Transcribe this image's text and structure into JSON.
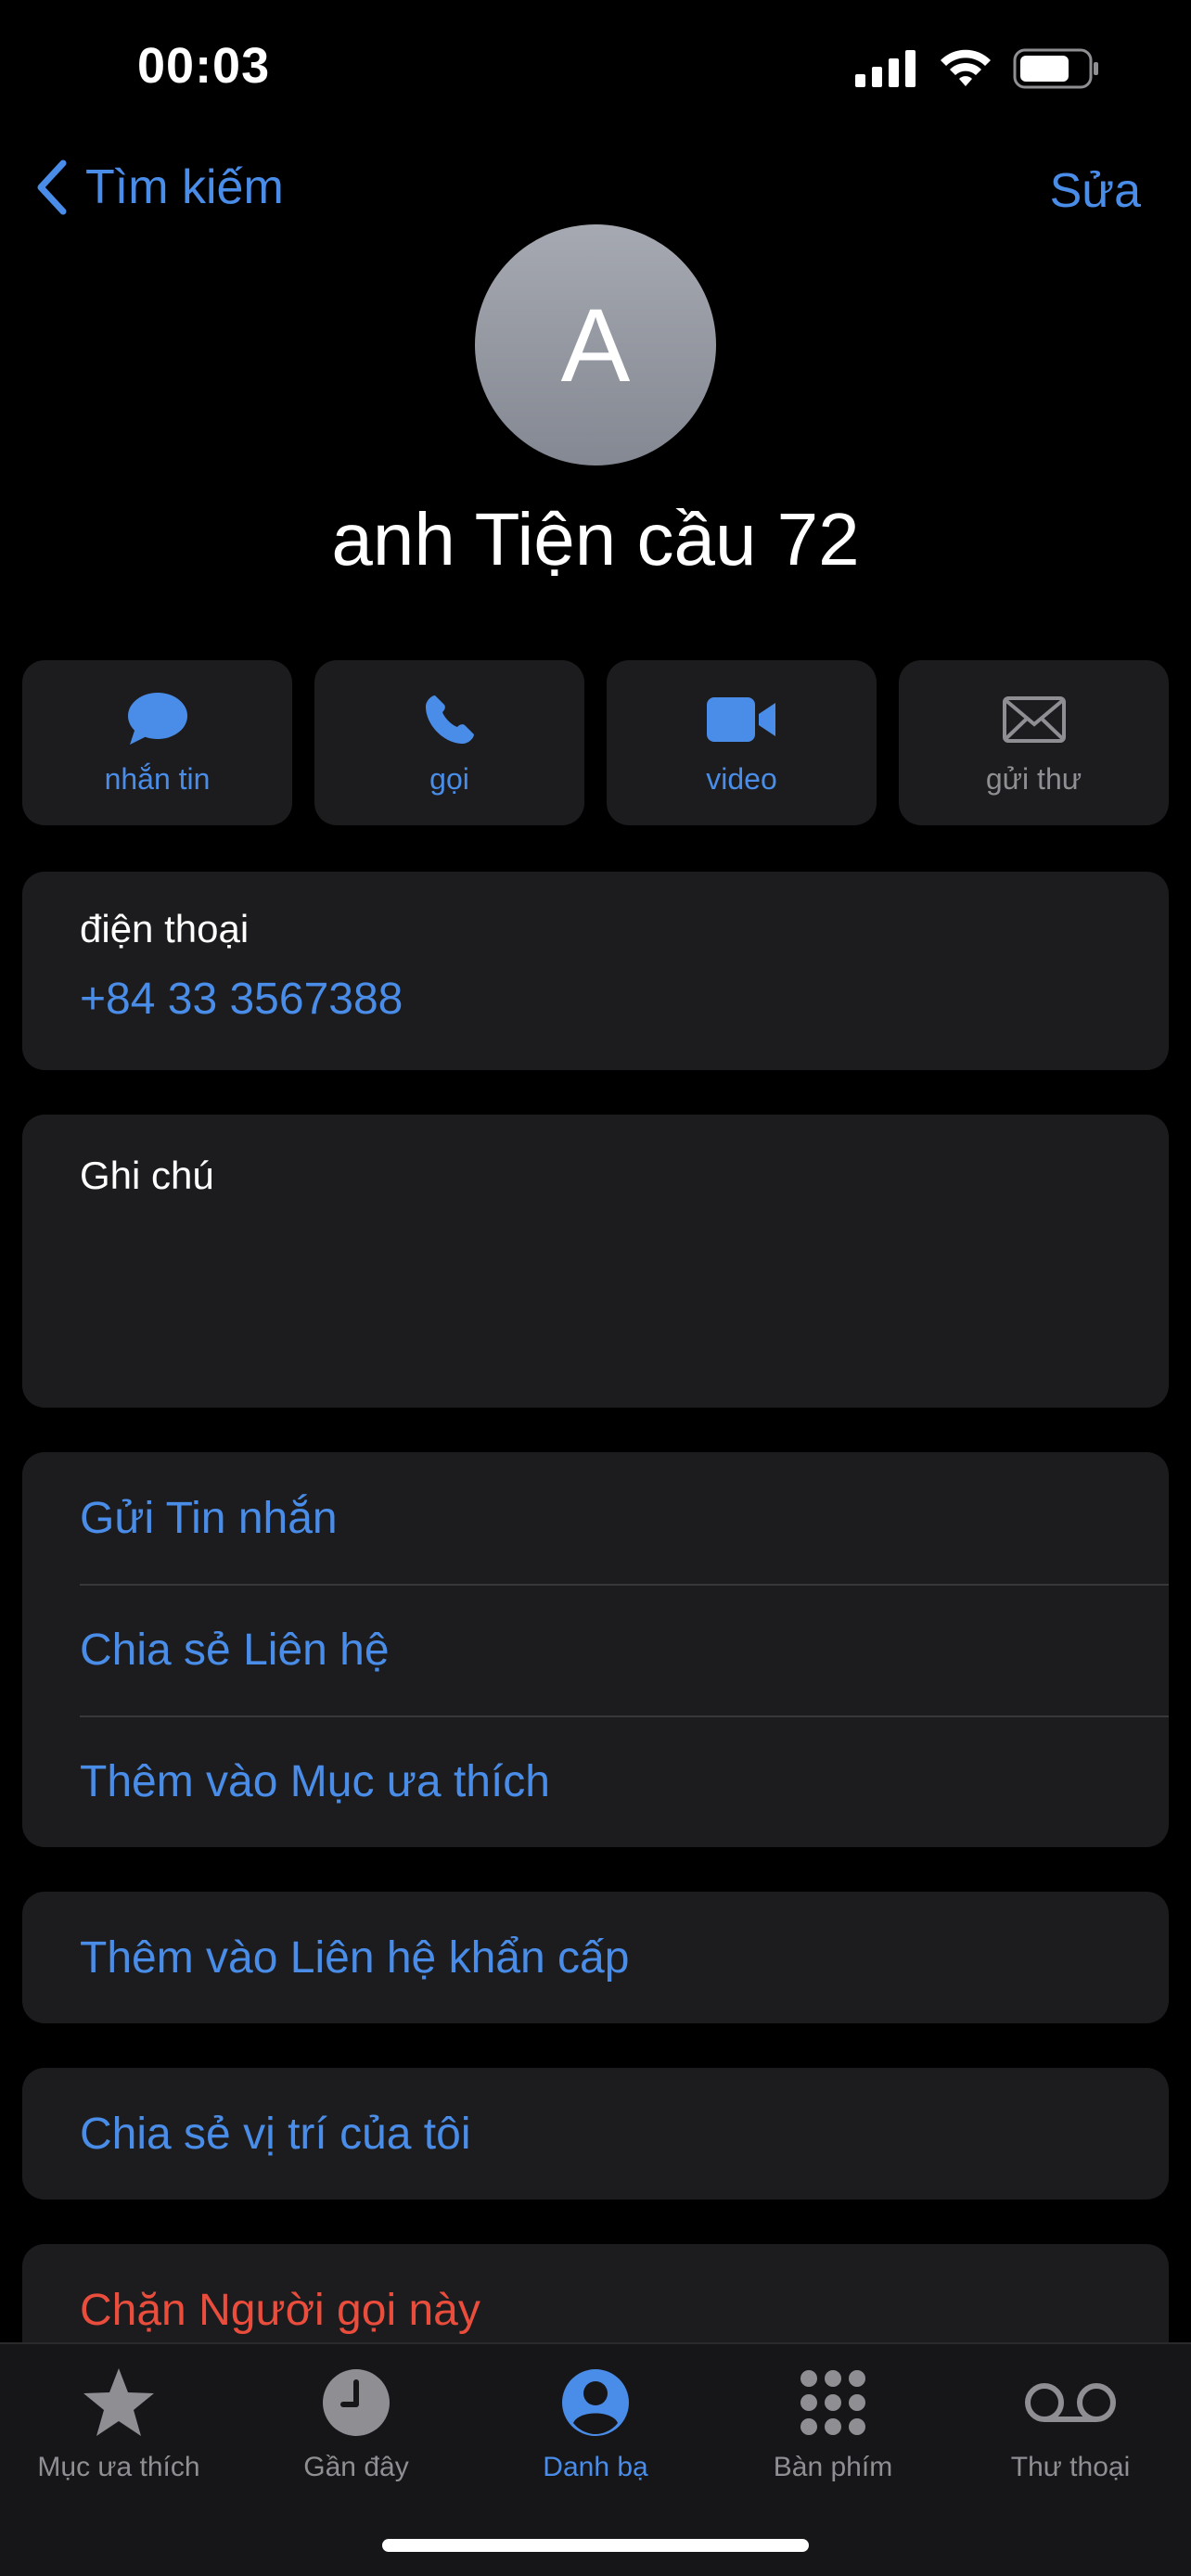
{
  "status_bar": {
    "time": "00:03",
    "icons": [
      "cellular-signal-icon",
      "wifi-icon",
      "battery-icon"
    ]
  },
  "nav": {
    "back_label": "Tìm kiếm",
    "edit_label": "Sửa"
  },
  "contact": {
    "initial": "A",
    "name": "anh Tiện cầu 72"
  },
  "actions": [
    {
      "label": "nhắn tin",
      "icon": "message-bubble-icon",
      "enabled": true
    },
    {
      "label": "gọi",
      "icon": "phone-icon",
      "enabled": true
    },
    {
      "label": "video",
      "icon": "video-camera-icon",
      "enabled": true
    },
    {
      "label": "gửi thư",
      "icon": "envelope-icon",
      "enabled": false
    }
  ],
  "phone": {
    "label": "điện thoại",
    "number": "+84 33 3567388"
  },
  "notes": {
    "label": "Ghi chú"
  },
  "options": {
    "send_message": "Gửi Tin nhắn",
    "share_contact": "Chia sẻ Liên hệ",
    "add_favorites": "Thêm vào Mục ưa thích",
    "add_emergency": "Thêm vào Liên hệ khẩn cấp",
    "share_location": "Chia sẻ vị trí của tôi",
    "block_caller": "Chặn Người gọi này"
  },
  "tabbar": {
    "tabs": [
      {
        "label": "Mục ưa thích",
        "icon": "star-icon",
        "active": false
      },
      {
        "label": "Gần đây",
        "icon": "clock-icon",
        "active": false
      },
      {
        "label": "Danh bạ",
        "icon": "person-circle-icon",
        "active": true
      },
      {
        "label": "Bàn phím",
        "icon": "keypad-icon",
        "active": false
      },
      {
        "label": "Thư thoại",
        "icon": "voicemail-icon",
        "active": false
      }
    ]
  },
  "colors": {
    "accent": "#4a8de8",
    "danger": "#eb4d3d",
    "card": "#1c1c1e",
    "background": "#000000"
  }
}
